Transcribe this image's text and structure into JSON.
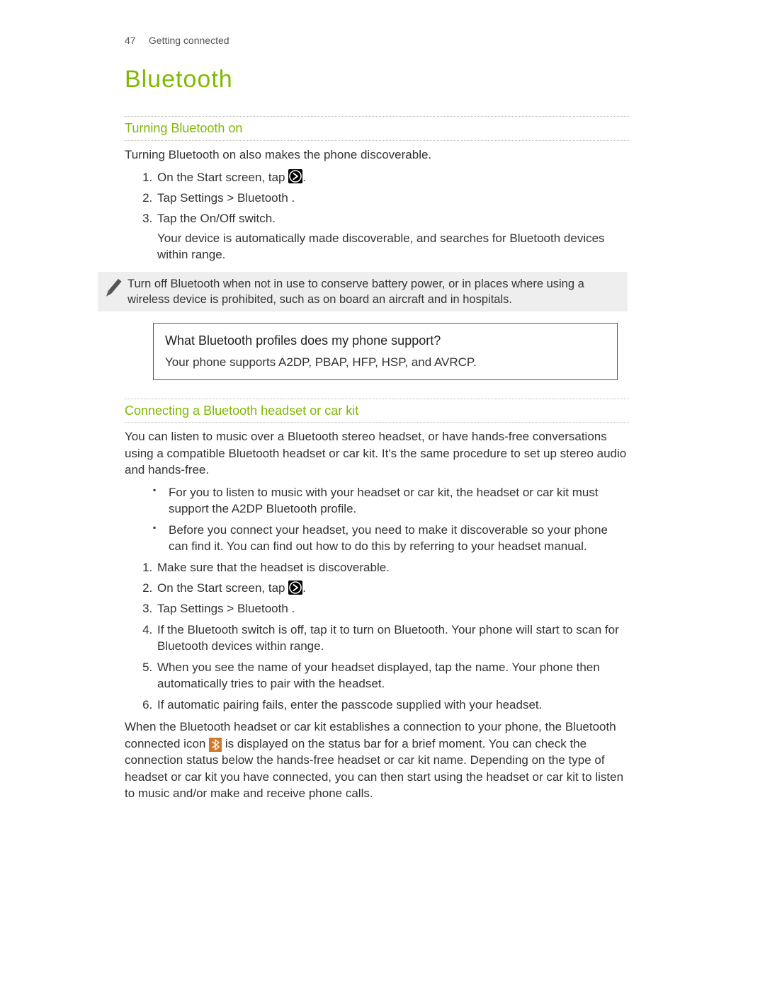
{
  "pageNumber": "47",
  "runningHeader": "Getting connected",
  "chapterTitle": "Bluetooth",
  "section1": {
    "heading": "Turning Bluetooth on",
    "intro": "Turning Bluetooth on also makes the phone discoverable.",
    "step1_pre": "On the Start screen, tap ",
    "step1_post": ".",
    "step2_pre": "Tap ",
    "step2_strong": "Settings > Bluetooth",
    "step2_post": " .",
    "step3_pre": "Tap the ",
    "step3_strong": "On/Off",
    "step3_post": " switch.",
    "step3_sub": "Your device is automatically made discoverable, and searches for Bluetooth devices within range."
  },
  "note": "Turn off Bluetooth when not in use to conserve battery power, or in places where using a wireless device is prohibited, such as on board an aircraft and in hospitals.",
  "profileBox": {
    "question": "What Bluetooth profiles does my phone support?",
    "answer": "Your phone supports A2DP, PBAP, HFP, HSP, and AVRCP."
  },
  "section2": {
    "heading": "Connecting a Bluetooth headset or car kit",
    "intro": "You can listen to music over a Bluetooth stereo headset, or have hands-free conversations using a compatible Bluetooth headset or car kit. It's the same procedure to set up stereo audio and hands-free.",
    "bullet1": "For you to listen to music with your headset or car kit, the headset or car kit must support the A2DP Bluetooth profile.",
    "bullet2": "Before you connect your headset, you need to make it discoverable so your phone can find it. You can find out how to do this by referring to your headset manual.",
    "step1": "Make sure that the headset is discoverable.",
    "step2_pre": "On the Start screen, tap ",
    "step2_post": ".",
    "step3_pre": "Tap ",
    "step3_strong": "Settings > Bluetooth",
    "step3_post": " .",
    "step4": "If the Bluetooth switch is off, tap it to turn on Bluetooth. Your phone will start to scan for Bluetooth devices within range.",
    "step5": "When you see the name of your headset displayed, tap the name. Your phone then automatically tries to pair with the headset.",
    "step6": "If automatic pairing fails, enter the passcode supplied with your headset.",
    "outro_pre": "When the Bluetooth headset or car kit establishes a connection to your phone, the Bluetooth connected icon ",
    "outro_post": " is displayed on the status bar for a brief moment. You can check the connection status below the hands-free headset or car kit name. Depending on the type of headset or car kit you have connected, you can then start using the headset or car kit to listen to music and/or make and receive phone calls."
  }
}
